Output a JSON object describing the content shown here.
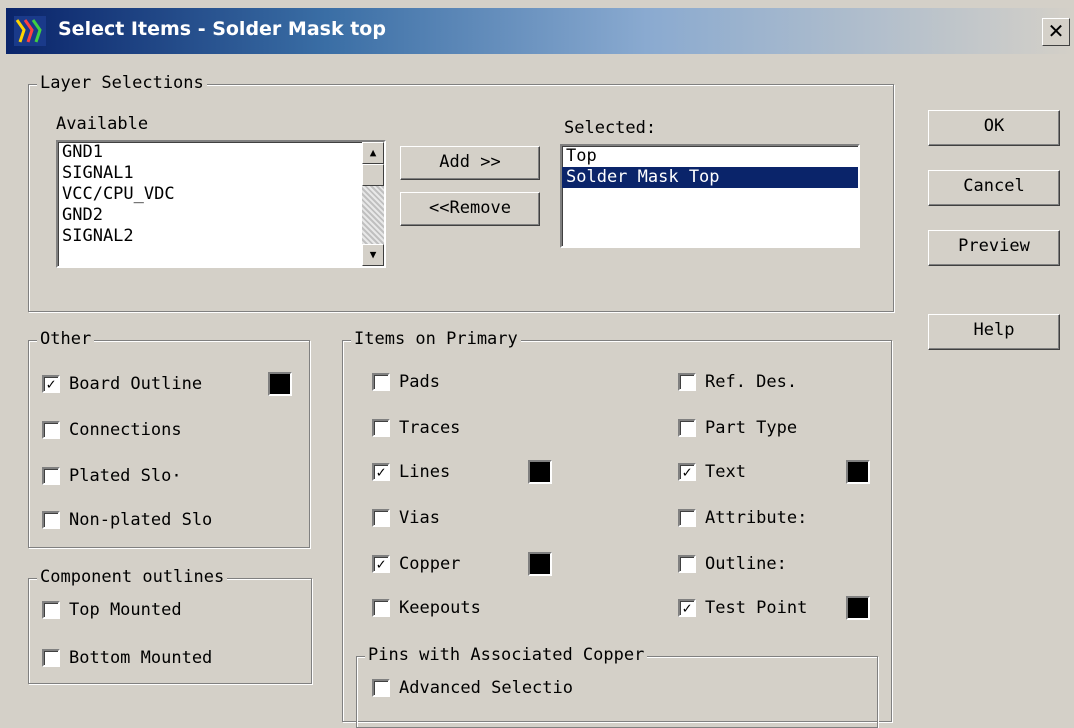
{
  "window": {
    "title": "Select Items - Solder Mask top",
    "close_glyph": "✕"
  },
  "layer_selections": {
    "legend": "Layer Selections",
    "available_label": "Available",
    "available_items": [
      "GND1",
      "SIGNAL1",
      "VCC/CPU_VDC",
      "GND2",
      "SIGNAL2"
    ],
    "selected_label": "Selected:",
    "selected_items": [
      "Top",
      "Solder Mask Top"
    ],
    "selected_highlight": "Solder Mask Top",
    "add_button": "Add >>",
    "remove_button": "<<Remove"
  },
  "buttons": {
    "ok": "OK",
    "cancel": "Cancel",
    "preview": "Preview",
    "help": "Help"
  },
  "other": {
    "legend": "Other",
    "items": [
      {
        "label": "Board Outline",
        "checked": true,
        "swatch": true
      },
      {
        "label": "Connections",
        "checked": false,
        "swatch": false
      },
      {
        "label": "Plated Slo·",
        "checked": false,
        "swatch": false
      },
      {
        "label": "Non-plated Slo",
        "checked": false,
        "swatch": false
      }
    ]
  },
  "component_outlines": {
    "legend": "Component outlines",
    "items": [
      {
        "label": "Top Mounted",
        "checked": false
      },
      {
        "label": "Bottom Mounted",
        "checked": false
      }
    ]
  },
  "items_on_primary": {
    "legend": "Items on Primary",
    "left": [
      {
        "label": "Pads",
        "checked": false,
        "swatch": false
      },
      {
        "label": "Traces",
        "checked": false,
        "swatch": false
      },
      {
        "label": "Lines",
        "checked": true,
        "swatch": true
      },
      {
        "label": "Vias",
        "checked": false,
        "swatch": false
      },
      {
        "label": "Copper",
        "checked": true,
        "swatch": true
      },
      {
        "label": "Keepouts",
        "checked": false,
        "swatch": false
      }
    ],
    "right": [
      {
        "label": "Ref. Des.",
        "checked": false,
        "swatch": false
      },
      {
        "label": "Part Type",
        "checked": false,
        "swatch": false
      },
      {
        "label": "Text",
        "checked": true,
        "swatch": true
      },
      {
        "label": "Attribute:",
        "checked": false,
        "swatch": false
      },
      {
        "label": "Outline:",
        "checked": false,
        "swatch": false
      },
      {
        "label": "Test Point",
        "checked": true,
        "swatch": true
      }
    ]
  },
  "pins_with_copper": {
    "legend": "Pins with Associated Copper",
    "items": [
      {
        "label": "Advanced Selectio",
        "checked": false
      }
    ]
  },
  "colors": {
    "title_bar": "#0a246a",
    "selection": "#0a246a",
    "dialog_bg": "#d4d0c8",
    "swatch": "#000000"
  }
}
